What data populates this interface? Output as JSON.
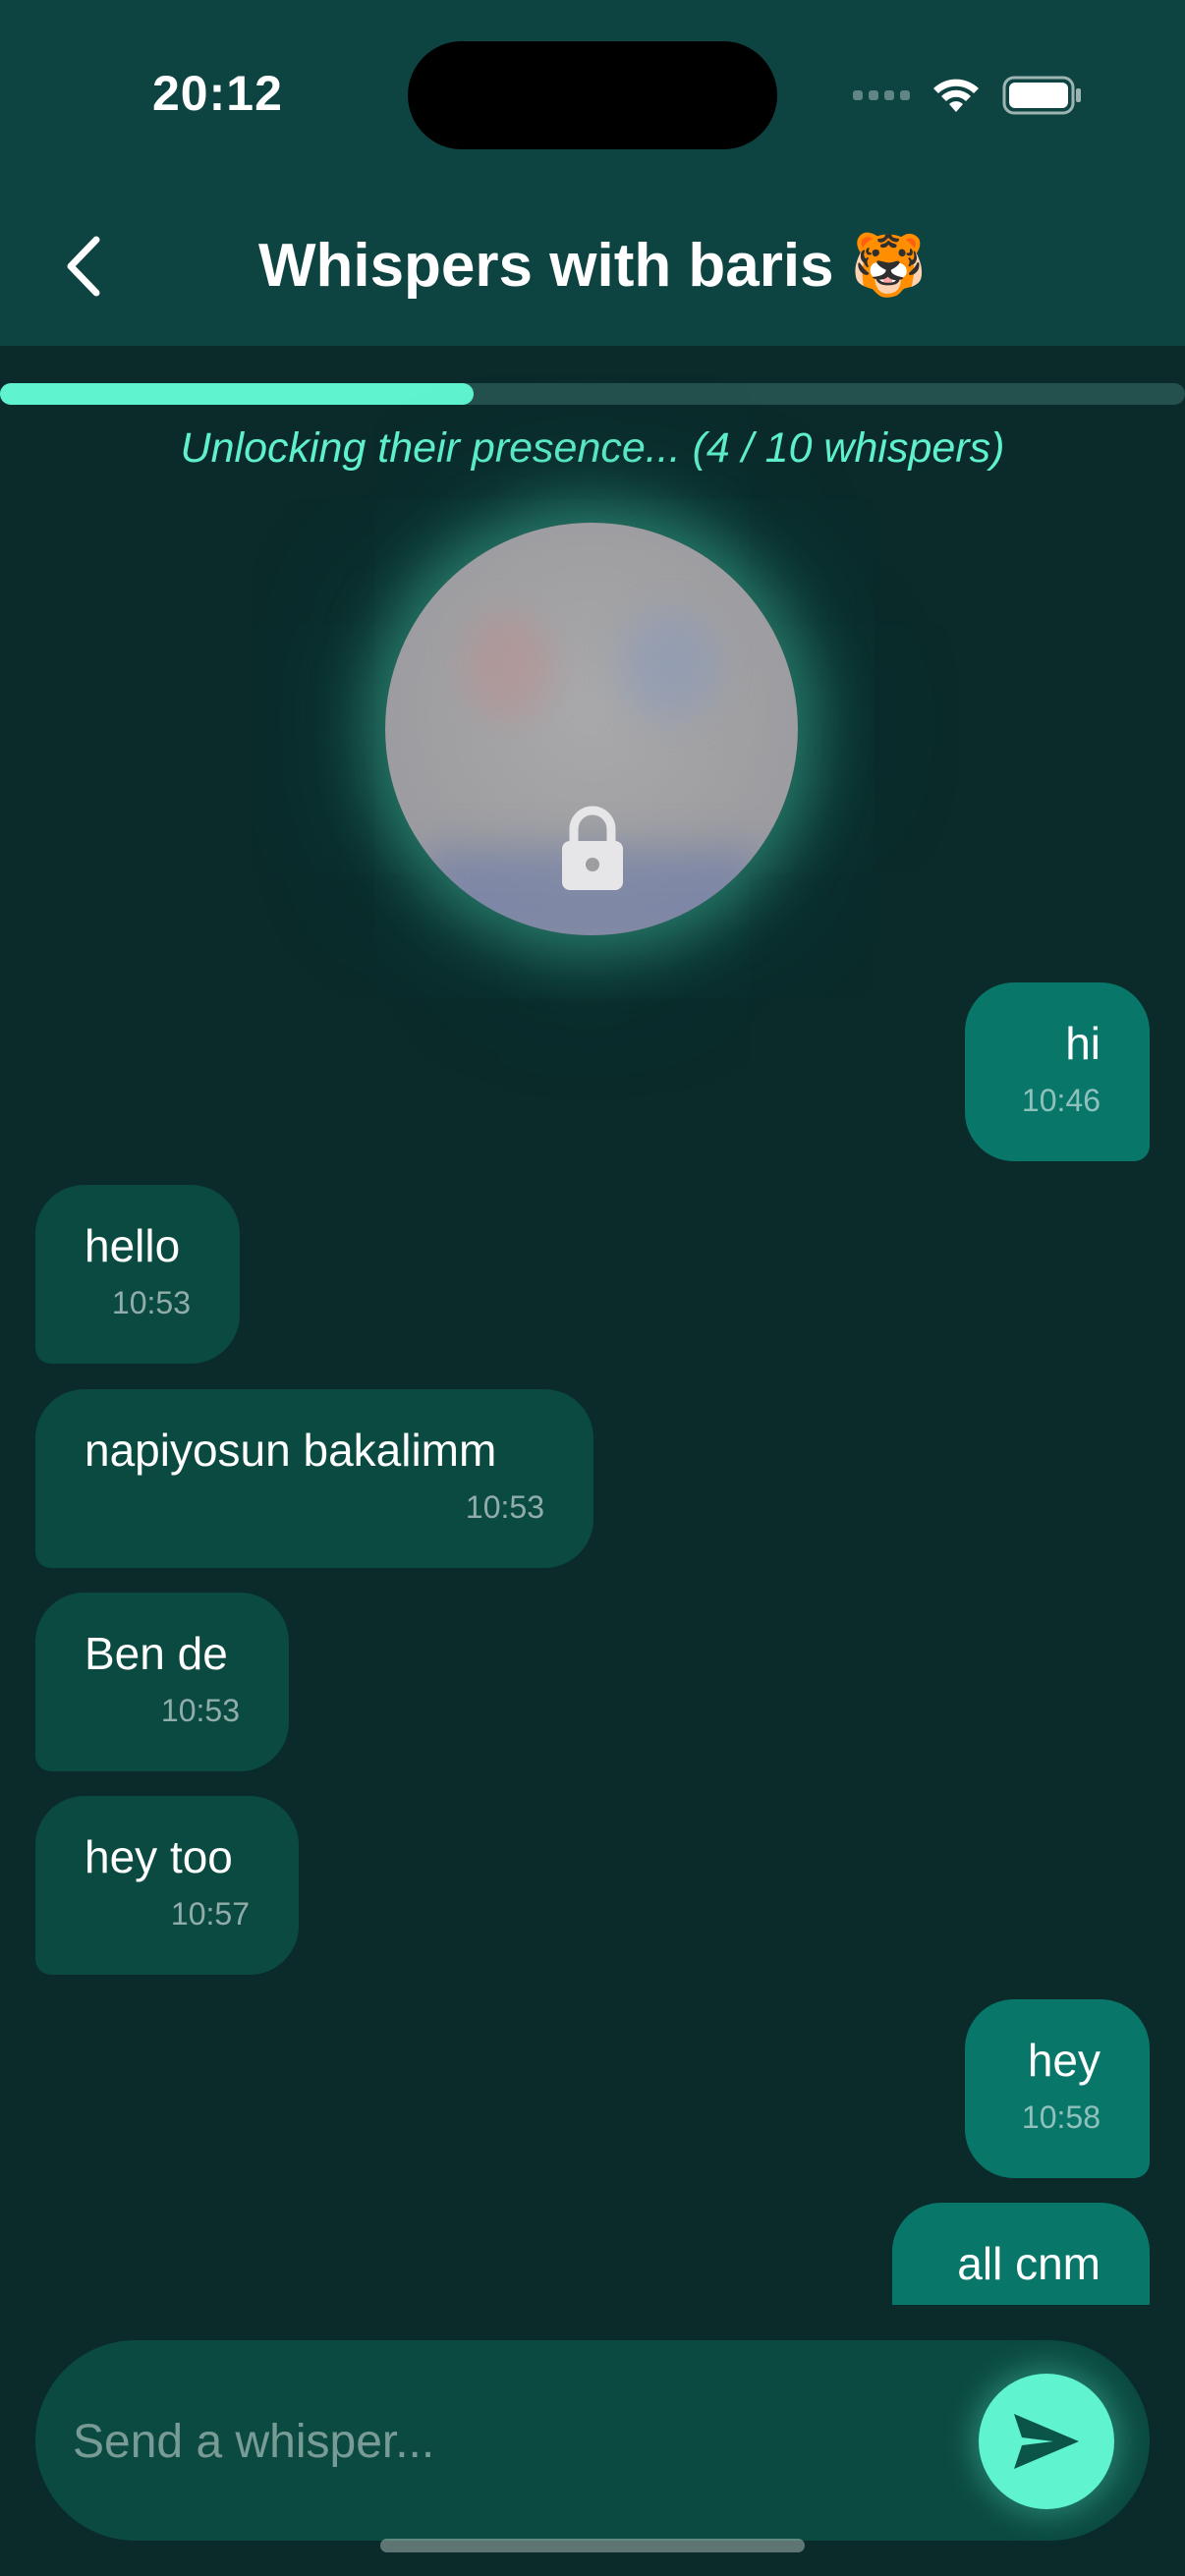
{
  "status_bar": {
    "time": "20:12"
  },
  "header": {
    "title": "Whispers with baris 🐯",
    "back_icon": "chevron-left-icon"
  },
  "progress": {
    "caption": "Unlocking their presence... (4 / 10 whispers)",
    "current": 4,
    "total": 10
  },
  "avatar": {
    "locked": true,
    "lock_icon": "lock-icon"
  },
  "messages": [
    {
      "direction": "out",
      "text": "hi",
      "time": "10:46"
    },
    {
      "direction": "in",
      "text": "hello",
      "time": "10:53"
    },
    {
      "direction": "in",
      "text": "napiyosun bakalimm",
      "time": "10:53"
    },
    {
      "direction": "in",
      "text": "Ben de",
      "time": "10:53"
    },
    {
      "direction": "in",
      "text": "hey too",
      "time": "10:57"
    },
    {
      "direction": "out",
      "text": "hey",
      "time": "10:58"
    },
    {
      "direction": "out",
      "text": "all cnm",
      "time": ""
    }
  ],
  "composer": {
    "placeholder": "Send a whisper...",
    "send_icon": "send-icon"
  },
  "colors": {
    "background": "#0a2b2a",
    "header": "#0d4442",
    "accent": "#5ff3cf",
    "incoming_bubble": "#0b4a41",
    "outgoing_bubble": "#08776a"
  }
}
